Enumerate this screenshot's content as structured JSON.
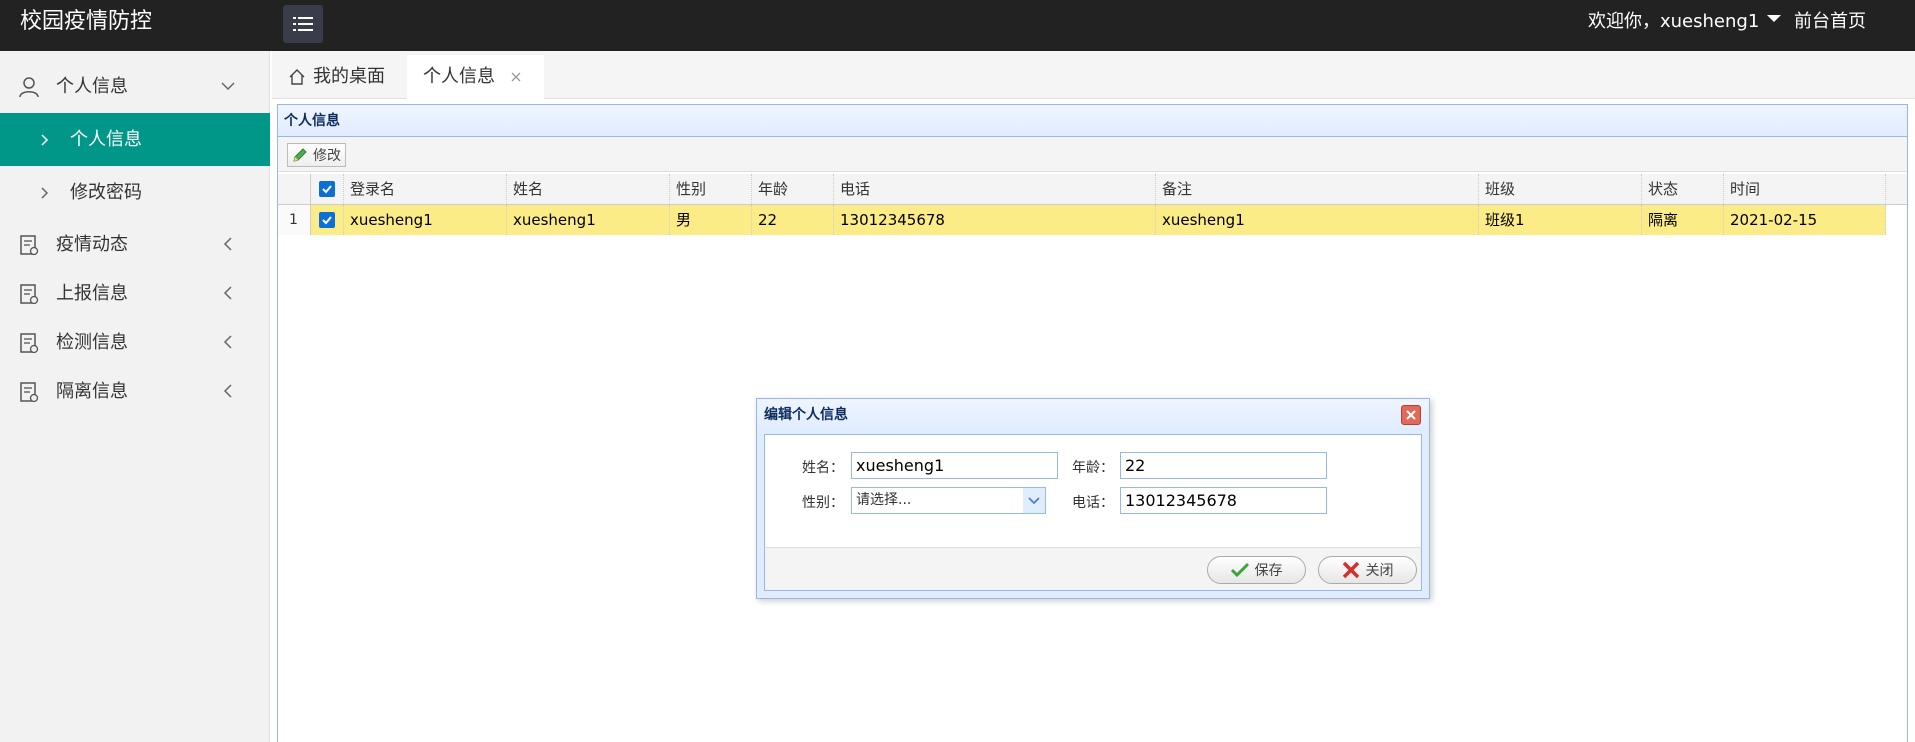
{
  "header": {
    "app_title": "校园疫情防控",
    "welcome": "欢迎你，xuesheng1",
    "front_link": "前台首页"
  },
  "sidebar": {
    "groups": [
      {
        "label": "个人信息",
        "icon": "user-icon",
        "expanded": true
      },
      {
        "label": "疫情动态",
        "icon": "document-icon"
      },
      {
        "label": "上报信息",
        "icon": "document-icon"
      },
      {
        "label": "检测信息",
        "icon": "document-icon"
      },
      {
        "label": "隔离信息",
        "icon": "document-icon"
      }
    ],
    "sub_items": [
      {
        "label": "个人信息",
        "active": true
      },
      {
        "label": "修改密码"
      }
    ]
  },
  "tabs": {
    "home": "我的桌面",
    "active": "个人信息"
  },
  "panel": {
    "title": "个人信息",
    "edit_button": "修改"
  },
  "grid": {
    "columns": [
      "登录名",
      "姓名",
      "性别",
      "年龄",
      "电话",
      "备注",
      "班级",
      "状态",
      "时间"
    ],
    "rows": [
      {
        "num": "1",
        "cells": [
          "xuesheng1",
          "xuesheng1",
          "男",
          "22",
          "13012345678",
          "xuesheng1",
          "班级1",
          "隔离",
          "2021-02-15"
        ]
      }
    ]
  },
  "dialog": {
    "title": "编辑个人信息",
    "name_label": "姓名：",
    "name_value": "xuesheng1",
    "age_label": "年龄：",
    "age_value": "22",
    "gender_label": "性别：",
    "gender_value": "请选择...",
    "phone_label": "电话：",
    "phone_value": "13012345678",
    "save": "保存",
    "close": "关闭"
  },
  "colors": {
    "header_bg": "#222222",
    "sidebar_active": "#009688",
    "row_selected": "#fbec88",
    "panel_border": "#95b8e7"
  }
}
